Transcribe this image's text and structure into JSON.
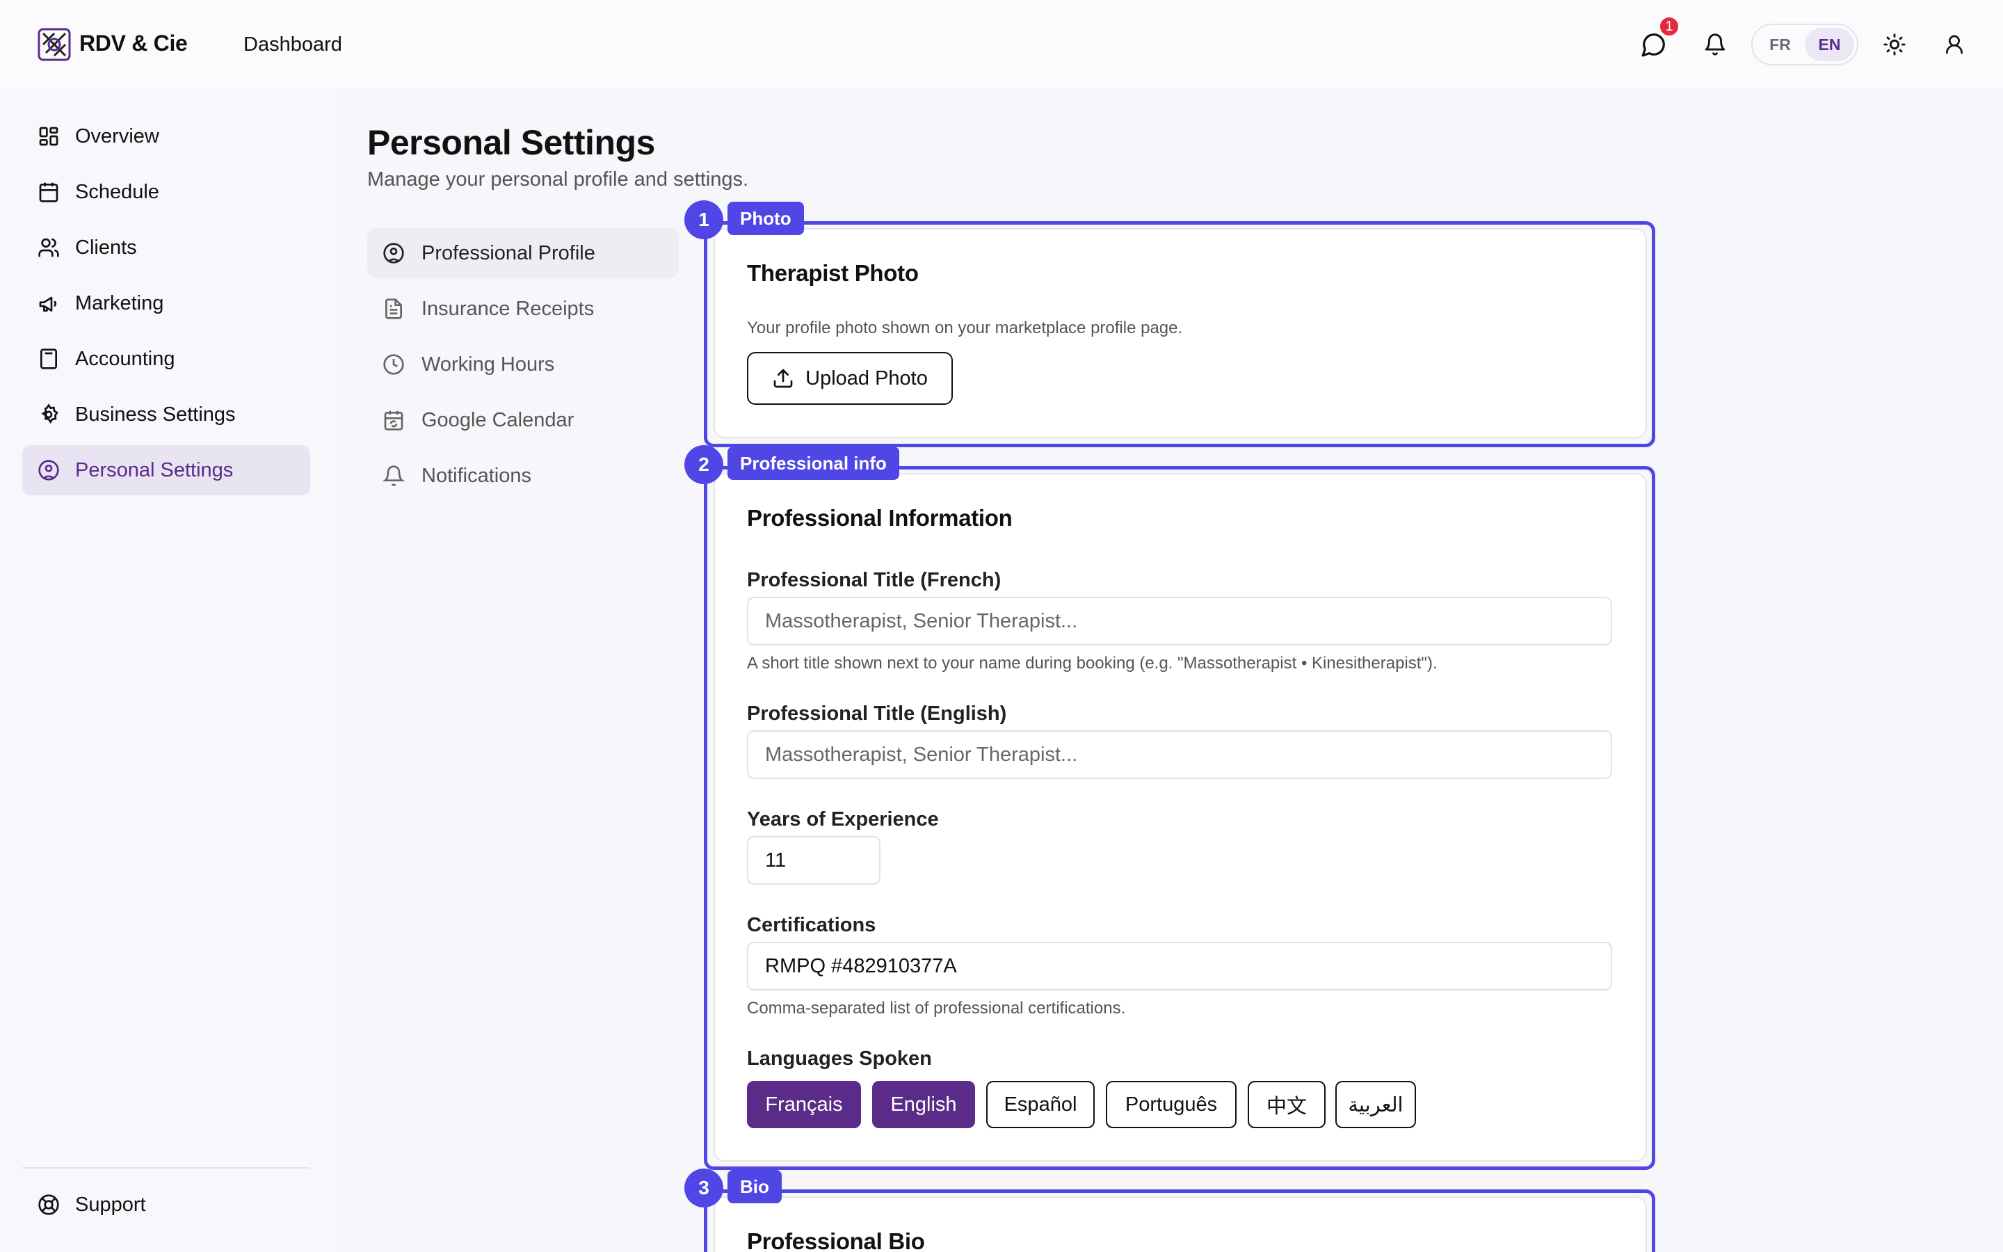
{
  "app": {
    "name": "RDV & Cie",
    "breadcrumb": "Dashboard"
  },
  "topbar": {
    "chat_badge": "1",
    "languages": [
      "FR",
      "EN"
    ],
    "active_language": "EN"
  },
  "sidebar": {
    "items": [
      {
        "label": "Overview",
        "icon": "grid-icon"
      },
      {
        "label": "Schedule",
        "icon": "calendar-icon"
      },
      {
        "label": "Clients",
        "icon": "users-icon"
      },
      {
        "label": "Marketing",
        "icon": "megaphone-icon"
      },
      {
        "label": "Accounting",
        "icon": "calculator-icon"
      },
      {
        "label": "Business Settings",
        "icon": "gear-icon"
      },
      {
        "label": "Personal Settings",
        "icon": "user-circle-icon"
      }
    ],
    "active": "Personal Settings",
    "support": "Support"
  },
  "page": {
    "title": "Personal Settings",
    "subtitle": "Manage your personal profile and settings."
  },
  "subnav": {
    "items": [
      {
        "label": "Professional Profile",
        "icon": "user-circle-icon"
      },
      {
        "label": "Insurance Receipts",
        "icon": "document-icon"
      },
      {
        "label": "Working Hours",
        "icon": "clock-icon"
      },
      {
        "label": "Google Calendar",
        "icon": "calendar-sync-icon"
      },
      {
        "label": "Notifications",
        "icon": "bell-icon"
      }
    ],
    "active": "Professional Profile"
  },
  "sections": [
    {
      "number": "1",
      "tag": "Photo"
    },
    {
      "number": "2",
      "tag": "Professional info"
    },
    {
      "number": "3",
      "tag": "Bio"
    }
  ],
  "photo_card": {
    "title": "Therapist Photo",
    "description": "Your profile photo shown on your marketplace profile page.",
    "upload_label": "Upload Photo"
  },
  "info_card": {
    "title": "Professional Information",
    "title_fr_label": "Professional Title (French)",
    "title_fr_placeholder": "Massotherapist, Senior Therapist...",
    "title_fr_help": "A short title shown next to your name during booking (e.g. \"Massotherapist • Kinesitherapist\").",
    "title_en_label": "Professional Title (English)",
    "title_en_placeholder": "Massotherapist, Senior Therapist...",
    "years_label": "Years of Experience",
    "years_value": "11",
    "cert_label": "Certifications",
    "cert_value": "RMPQ #482910377A",
    "cert_help": "Comma-separated list of professional certifications.",
    "languages_label": "Languages Spoken",
    "languages": [
      "Français",
      "English",
      "Español",
      "Português",
      "中文",
      "العربية"
    ],
    "selected_languages": [
      "Français",
      "English"
    ]
  },
  "bio_card": {
    "title": "Professional Bio"
  },
  "colors": {
    "accent": "#5b2b8a",
    "annotation": "#4f46e5",
    "badge": "#e5283f"
  }
}
